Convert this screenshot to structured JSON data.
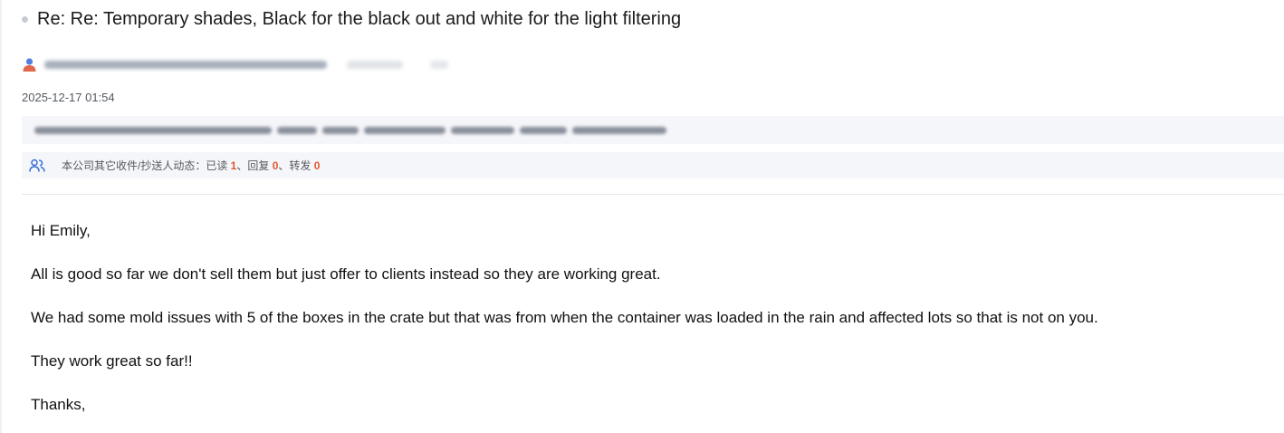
{
  "email": {
    "subject": "Re: Re: Temporary shades, Black for the black out and white for the light filtering",
    "date": "2025-12-17 01:54",
    "activity": {
      "label": "本公司其它收件/抄送人动态：已读 ",
      "read_count": "1",
      "reply_label": "、回复 ",
      "reply_count": "0",
      "forward_label": "、转发 ",
      "forward_count": "0"
    },
    "body_lines": [
      "Hi Emily,",
      "All is good so far we don't sell them but just offer to clients instead so they are working great.",
      "We had some mold issues with 5 of the boxes in the crate but that was from when the container was loaded in the rain and affected lots so that is not on you.",
      "They work great so far!!",
      "Thanks,"
    ]
  },
  "icons": {
    "sender": "person-icon",
    "activity": "people-icon"
  },
  "colors": {
    "count_highlight": "#e4572e",
    "panel_background": "#f5f6f9",
    "people_icon": "#3b6fd6"
  }
}
